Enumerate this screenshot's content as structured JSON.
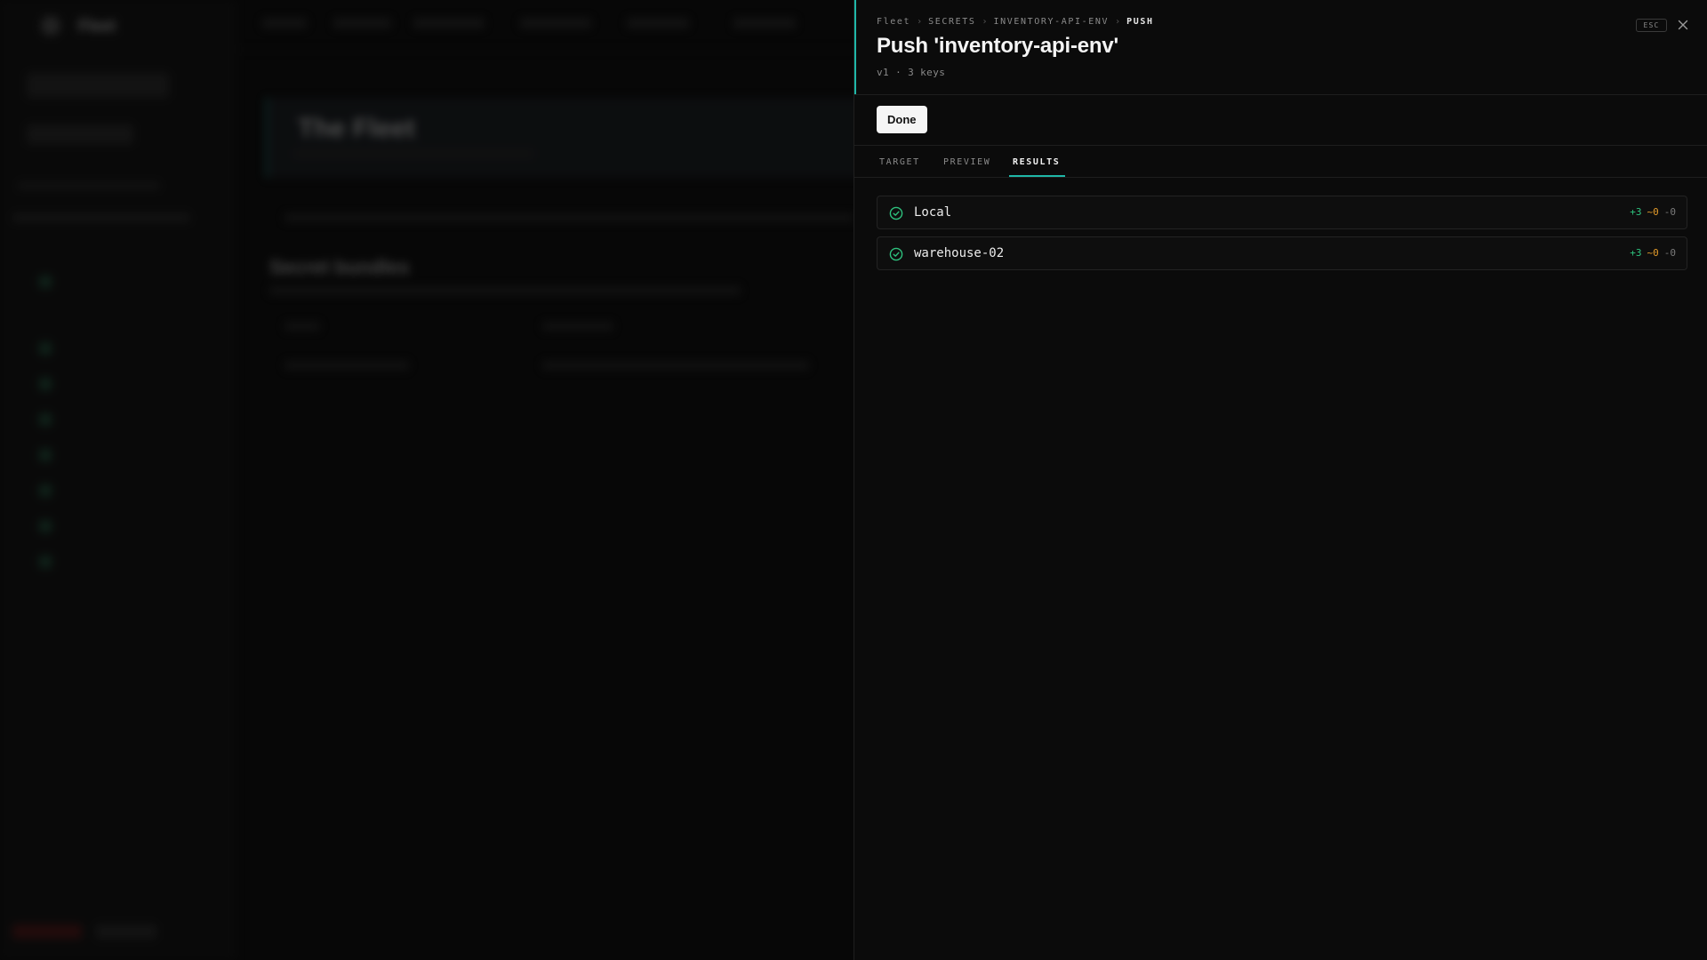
{
  "colors": {
    "accent": "#1fb7a8",
    "success": "#2ec27e",
    "added": "#2ec27e",
    "modified": "#e39b2b",
    "removed": "#7a7a7a"
  },
  "background": {
    "app_name": "Fleet",
    "hero_title": "The Fleet",
    "section_title": "Secret bundles"
  },
  "drawer": {
    "breadcrumb": [
      "Fleet",
      "SECRETS",
      "INVENTORY-API-ENV",
      "PUSH"
    ],
    "title": "Push 'inventory-api-env'",
    "meta": "v1 · 3 keys",
    "esc_label": "ESC",
    "close_icon": "close-icon",
    "done_label": "Done",
    "tabs": [
      {
        "label": "TARGET",
        "active": false
      },
      {
        "label": "PREVIEW",
        "active": false
      },
      {
        "label": "RESULTS",
        "active": true
      }
    ],
    "results": [
      {
        "name": "Local",
        "status_icon": "check-circle-icon",
        "added": "+3",
        "modified": "~0",
        "removed": "-0"
      },
      {
        "name": "warehouse-02",
        "status_icon": "check-circle-icon",
        "added": "+3",
        "modified": "~0",
        "removed": "-0"
      }
    ]
  }
}
